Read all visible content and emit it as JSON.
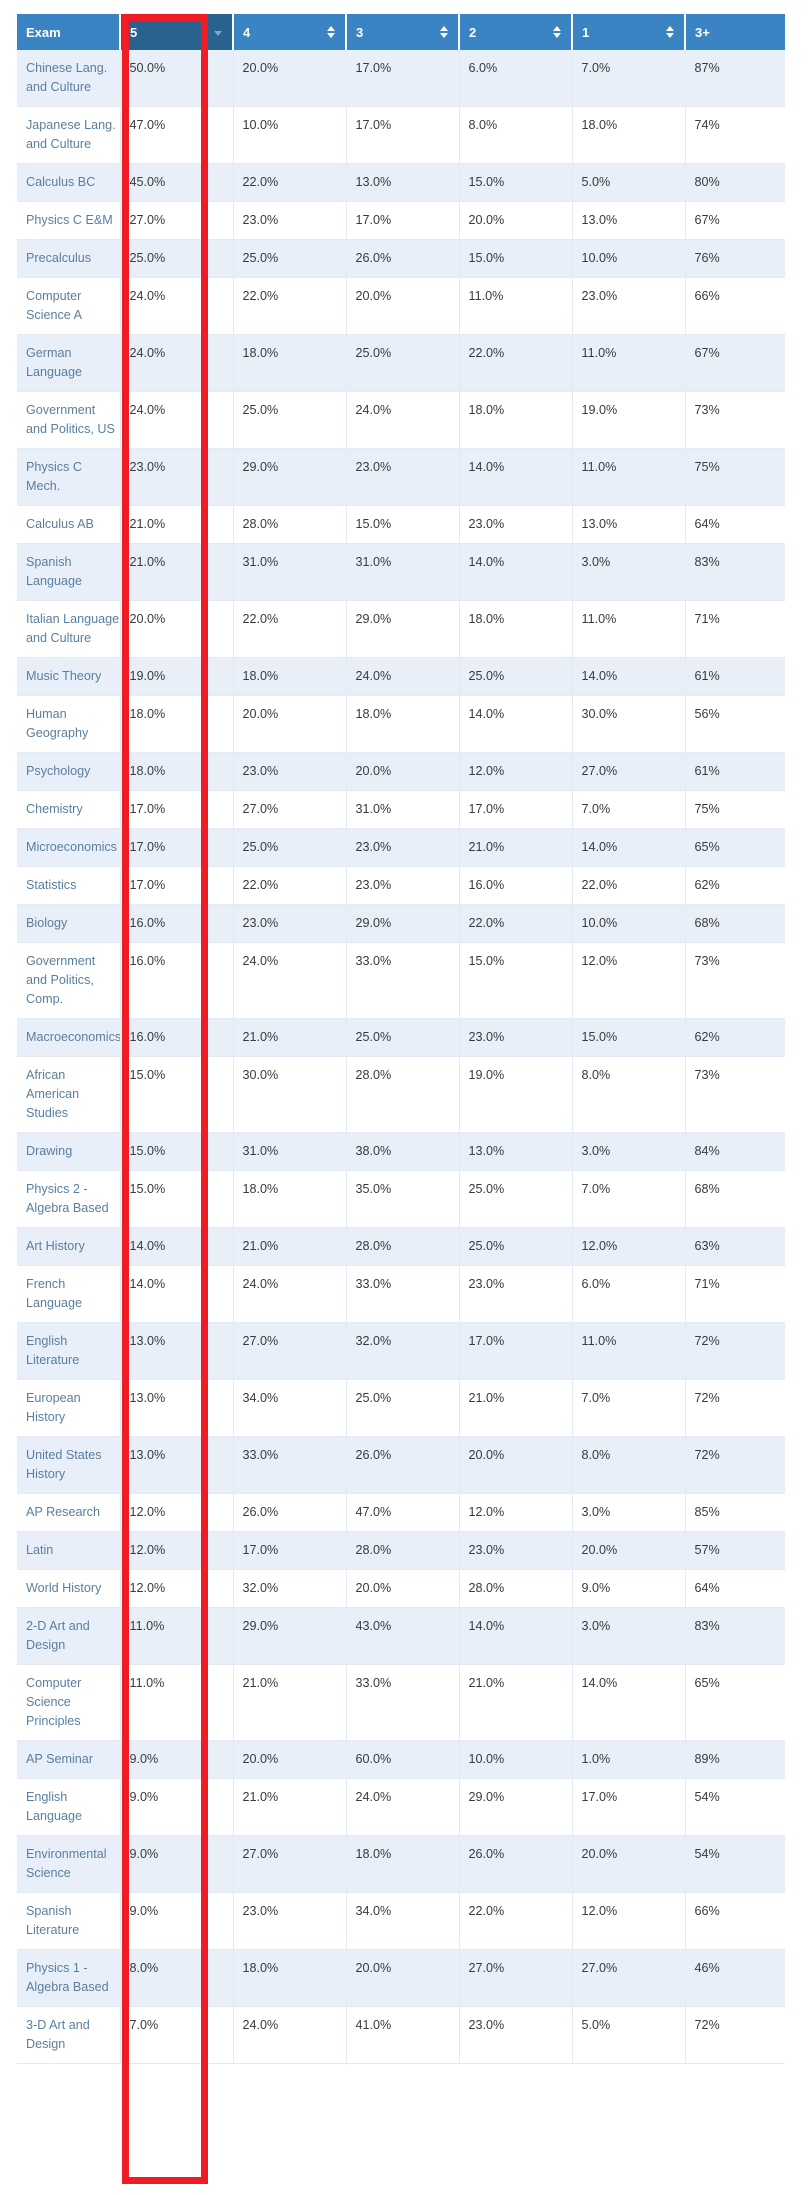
{
  "table": {
    "columns": [
      {
        "label": "Exam",
        "sortable": false,
        "sorted": false,
        "icon": "none"
      },
      {
        "label": "5",
        "sortable": true,
        "sorted": true,
        "icon": "sort-descending-icon"
      },
      {
        "label": "4",
        "sortable": true,
        "sorted": false,
        "icon": "sort-both-icon"
      },
      {
        "label": "3",
        "sortable": true,
        "sorted": false,
        "icon": "sort-both-icon"
      },
      {
        "label": "2",
        "sortable": true,
        "sorted": false,
        "icon": "sort-both-icon"
      },
      {
        "label": "1",
        "sortable": true,
        "sorted": false,
        "icon": "sort-both-icon"
      },
      {
        "label": "3+",
        "sortable": false,
        "sorted": false,
        "icon": "none"
      }
    ],
    "sorted_by": "5",
    "sort_direction": "descending",
    "rows": [
      {
        "exam": "Chinese Lang. and Culture",
        "s5": "50.0%",
        "s4": "20.0%",
        "s3": "17.0%",
        "s2": "6.0%",
        "s1": "7.0%",
        "s3plus": "87%"
      },
      {
        "exam": "Japanese Lang. and Culture",
        "s5": "47.0%",
        "s4": "10.0%",
        "s3": "17.0%",
        "s2": "8.0%",
        "s1": "18.0%",
        "s3plus": "74%"
      },
      {
        "exam": "Calculus BC",
        "s5": "45.0%",
        "s4": "22.0%",
        "s3": "13.0%",
        "s2": "15.0%",
        "s1": "5.0%",
        "s3plus": "80%"
      },
      {
        "exam": "Physics C E&M",
        "s5": "27.0%",
        "s4": "23.0%",
        "s3": "17.0%",
        "s2": "20.0%",
        "s1": "13.0%",
        "s3plus": "67%"
      },
      {
        "exam": "Precalculus",
        "s5": "25.0%",
        "s4": "25.0%",
        "s3": "26.0%",
        "s2": "15.0%",
        "s1": "10.0%",
        "s3plus": "76%"
      },
      {
        "exam": "Computer Science A",
        "s5": "24.0%",
        "s4": "22.0%",
        "s3": "20.0%",
        "s2": "11.0%",
        "s1": "23.0%",
        "s3plus": "66%"
      },
      {
        "exam": "German Language",
        "s5": "24.0%",
        "s4": "18.0%",
        "s3": "25.0%",
        "s2": "22.0%",
        "s1": "11.0%",
        "s3plus": "67%"
      },
      {
        "exam": "Government and Politics, US",
        "s5": "24.0%",
        "s4": "25.0%",
        "s3": "24.0%",
        "s2": "18.0%",
        "s1": "19.0%",
        "s3plus": "73%"
      },
      {
        "exam": "Physics C Mech.",
        "s5": "23.0%",
        "s4": "29.0%",
        "s3": "23.0%",
        "s2": "14.0%",
        "s1": "11.0%",
        "s3plus": "75%"
      },
      {
        "exam": "Calculus AB",
        "s5": "21.0%",
        "s4": "28.0%",
        "s3": "15.0%",
        "s2": "23.0%",
        "s1": "13.0%",
        "s3plus": "64%"
      },
      {
        "exam": "Spanish Language",
        "s5": "21.0%",
        "s4": "31.0%",
        "s3": "31.0%",
        "s2": "14.0%",
        "s1": "3.0%",
        "s3plus": "83%"
      },
      {
        "exam": "Italian Language and Culture",
        "s5": "20.0%",
        "s4": "22.0%",
        "s3": "29.0%",
        "s2": "18.0%",
        "s1": "11.0%",
        "s3plus": "71%"
      },
      {
        "exam": "Music Theory",
        "s5": "19.0%",
        "s4": "18.0%",
        "s3": "24.0%",
        "s2": "25.0%",
        "s1": "14.0%",
        "s3plus": "61%"
      },
      {
        "exam": "Human Geography",
        "s5": "18.0%",
        "s4": "20.0%",
        "s3": "18.0%",
        "s2": "14.0%",
        "s1": "30.0%",
        "s3plus": "56%"
      },
      {
        "exam": "Psychology",
        "s5": "18.0%",
        "s4": "23.0%",
        "s3": "20.0%",
        "s2": "12.0%",
        "s1": "27.0%",
        "s3plus": "61%"
      },
      {
        "exam": "Chemistry",
        "s5": "17.0%",
        "s4": "27.0%",
        "s3": "31.0%",
        "s2": "17.0%",
        "s1": "7.0%",
        "s3plus": "75%"
      },
      {
        "exam": "Microeconomics",
        "s5": "17.0%",
        "s4": "25.0%",
        "s3": "23.0%",
        "s2": "21.0%",
        "s1": "14.0%",
        "s3plus": "65%"
      },
      {
        "exam": "Statistics",
        "s5": "17.0%",
        "s4": "22.0%",
        "s3": "23.0%",
        "s2": "16.0%",
        "s1": "22.0%",
        "s3plus": "62%"
      },
      {
        "exam": "Biology",
        "s5": "16.0%",
        "s4": "23.0%",
        "s3": "29.0%",
        "s2": "22.0%",
        "s1": "10.0%",
        "s3plus": "68%"
      },
      {
        "exam": "Government and Politics, Comp.",
        "s5": "16.0%",
        "s4": "24.0%",
        "s3": "33.0%",
        "s2": "15.0%",
        "s1": "12.0%",
        "s3plus": "73%"
      },
      {
        "exam": "Macroeconomics",
        "s5": "16.0%",
        "s4": "21.0%",
        "s3": "25.0%",
        "s2": "23.0%",
        "s1": "15.0%",
        "s3plus": "62%"
      },
      {
        "exam": "African American Studies",
        "s5": "15.0%",
        "s4": "30.0%",
        "s3": "28.0%",
        "s2": "19.0%",
        "s1": "8.0%",
        "s3plus": "73%"
      },
      {
        "exam": "Drawing",
        "s5": "15.0%",
        "s4": "31.0%",
        "s3": "38.0%",
        "s2": "13.0%",
        "s1": "3.0%",
        "s3plus": "84%"
      },
      {
        "exam": "Physics 2 - Algebra Based",
        "s5": "15.0%",
        "s4": "18.0%",
        "s3": "35.0%",
        "s2": "25.0%",
        "s1": "7.0%",
        "s3plus": "68%"
      },
      {
        "exam": "Art History",
        "s5": "14.0%",
        "s4": "21.0%",
        "s3": "28.0%",
        "s2": "25.0%",
        "s1": "12.0%",
        "s3plus": "63%"
      },
      {
        "exam": "French Language",
        "s5": "14.0%",
        "s4": "24.0%",
        "s3": "33.0%",
        "s2": "23.0%",
        "s1": "6.0%",
        "s3plus": "71%"
      },
      {
        "exam": "English Literature",
        "s5": "13.0%",
        "s4": "27.0%",
        "s3": "32.0%",
        "s2": "17.0%",
        "s1": "11.0%",
        "s3plus": "72%"
      },
      {
        "exam": "European History",
        "s5": "13.0%",
        "s4": "34.0%",
        "s3": "25.0%",
        "s2": "21.0%",
        "s1": "7.0%",
        "s3plus": "72%"
      },
      {
        "exam": "United States History",
        "s5": "13.0%",
        "s4": "33.0%",
        "s3": "26.0%",
        "s2": "20.0%",
        "s1": "8.0%",
        "s3plus": "72%"
      },
      {
        "exam": "AP Research",
        "s5": "12.0%",
        "s4": "26.0%",
        "s3": "47.0%",
        "s2": "12.0%",
        "s1": "3.0%",
        "s3plus": "85%"
      },
      {
        "exam": "Latin",
        "s5": "12.0%",
        "s4": "17.0%",
        "s3": "28.0%",
        "s2": "23.0%",
        "s1": "20.0%",
        "s3plus": "57%"
      },
      {
        "exam": "World History",
        "s5": "12.0%",
        "s4": "32.0%",
        "s3": "20.0%",
        "s2": "28.0%",
        "s1": "9.0%",
        "s3plus": "64%"
      },
      {
        "exam": "2-D Art and Design",
        "s5": "11.0%",
        "s4": "29.0%",
        "s3": "43.0%",
        "s2": "14.0%",
        "s1": "3.0%",
        "s3plus": "83%"
      },
      {
        "exam": "Computer Science Principles",
        "s5": "11.0%",
        "s4": "21.0%",
        "s3": "33.0%",
        "s2": "21.0%",
        "s1": "14.0%",
        "s3plus": "65%"
      },
      {
        "exam": "AP Seminar",
        "s5": "9.0%",
        "s4": "20.0%",
        "s3": "60.0%",
        "s2": "10.0%",
        "s1": "1.0%",
        "s3plus": "89%"
      },
      {
        "exam": "English Language",
        "s5": "9.0%",
        "s4": "21.0%",
        "s3": "24.0%",
        "s2": "29.0%",
        "s1": "17.0%",
        "s3plus": "54%"
      },
      {
        "exam": "Environmental Science",
        "s5": "9.0%",
        "s4": "27.0%",
        "s3": "18.0%",
        "s2": "26.0%",
        "s1": "20.0%",
        "s3plus": "54%"
      },
      {
        "exam": "Spanish Literature",
        "s5": "9.0%",
        "s4": "23.0%",
        "s3": "34.0%",
        "s2": "22.0%",
        "s1": "12.0%",
        "s3plus": "66%"
      },
      {
        "exam": "Physics 1 - Algebra Based",
        "s5": "8.0%",
        "s4": "18.0%",
        "s3": "20.0%",
        "s2": "27.0%",
        "s1": "27.0%",
        "s3plus": "46%"
      },
      {
        "exam": "3-D Art and Design",
        "s5": "7.0%",
        "s4": "24.0%",
        "s3": "41.0%",
        "s2": "23.0%",
        "s1": "5.0%",
        "s3plus": "72%"
      }
    ]
  },
  "annotation": {
    "shape": "rectangle",
    "target_column": "5",
    "color": "#ee1c25"
  },
  "colors": {
    "header_bg": "#3b84c4",
    "header_sorted_bg": "#2a628f",
    "row_odd_bg": "#e9eff8",
    "row_even_bg": "#ffffff",
    "exam_text": "#5a7f9e",
    "value_text": "#3a3a3a",
    "annotation": "#ee1c25"
  }
}
